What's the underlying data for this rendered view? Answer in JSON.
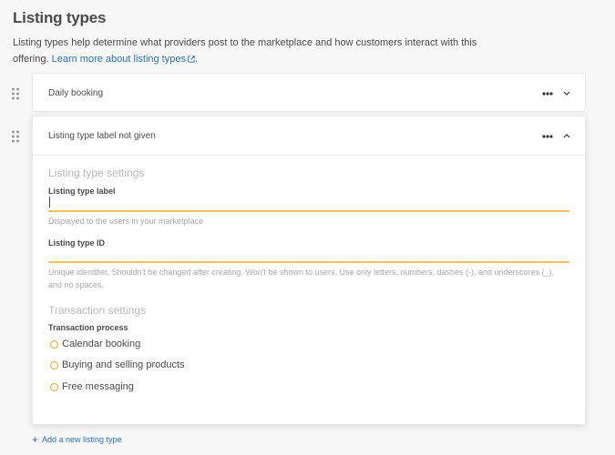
{
  "page": {
    "title": "Listing types",
    "intro_text": "Listing types help determine what providers post to the marketplace and how customers interact with this offering. ",
    "intro_link": "Learn more about listing types",
    "add_link": "Add a new listing type",
    "add_icon": "+"
  },
  "cards": [
    {
      "title": "Daily booking",
      "state": "collapsed"
    },
    {
      "title": "Listing type label not given",
      "state": "expanded"
    }
  ],
  "form": {
    "listing_settings_title": "Listing type settings",
    "label_field": {
      "label": "Listing type label",
      "value": "",
      "help": "Displayed to the users in your marketplace"
    },
    "id_field": {
      "label": "Listing type ID",
      "value": "",
      "help": "Unique identifier. Shouldn't be changed after creating. Won't be shown to users. Use only letters, numbers, dashes (-), and underscores (_), and no spaces."
    },
    "transaction_settings_title": "Transaction settings",
    "transaction_process_label": "Transaction process",
    "transaction_options": [
      "Calendar booking",
      "Buying and selling products",
      "Free messaging"
    ]
  },
  "colors": {
    "accent": "#f0c35a",
    "radio": "#e5a51d",
    "link": "#2e6fb7"
  }
}
